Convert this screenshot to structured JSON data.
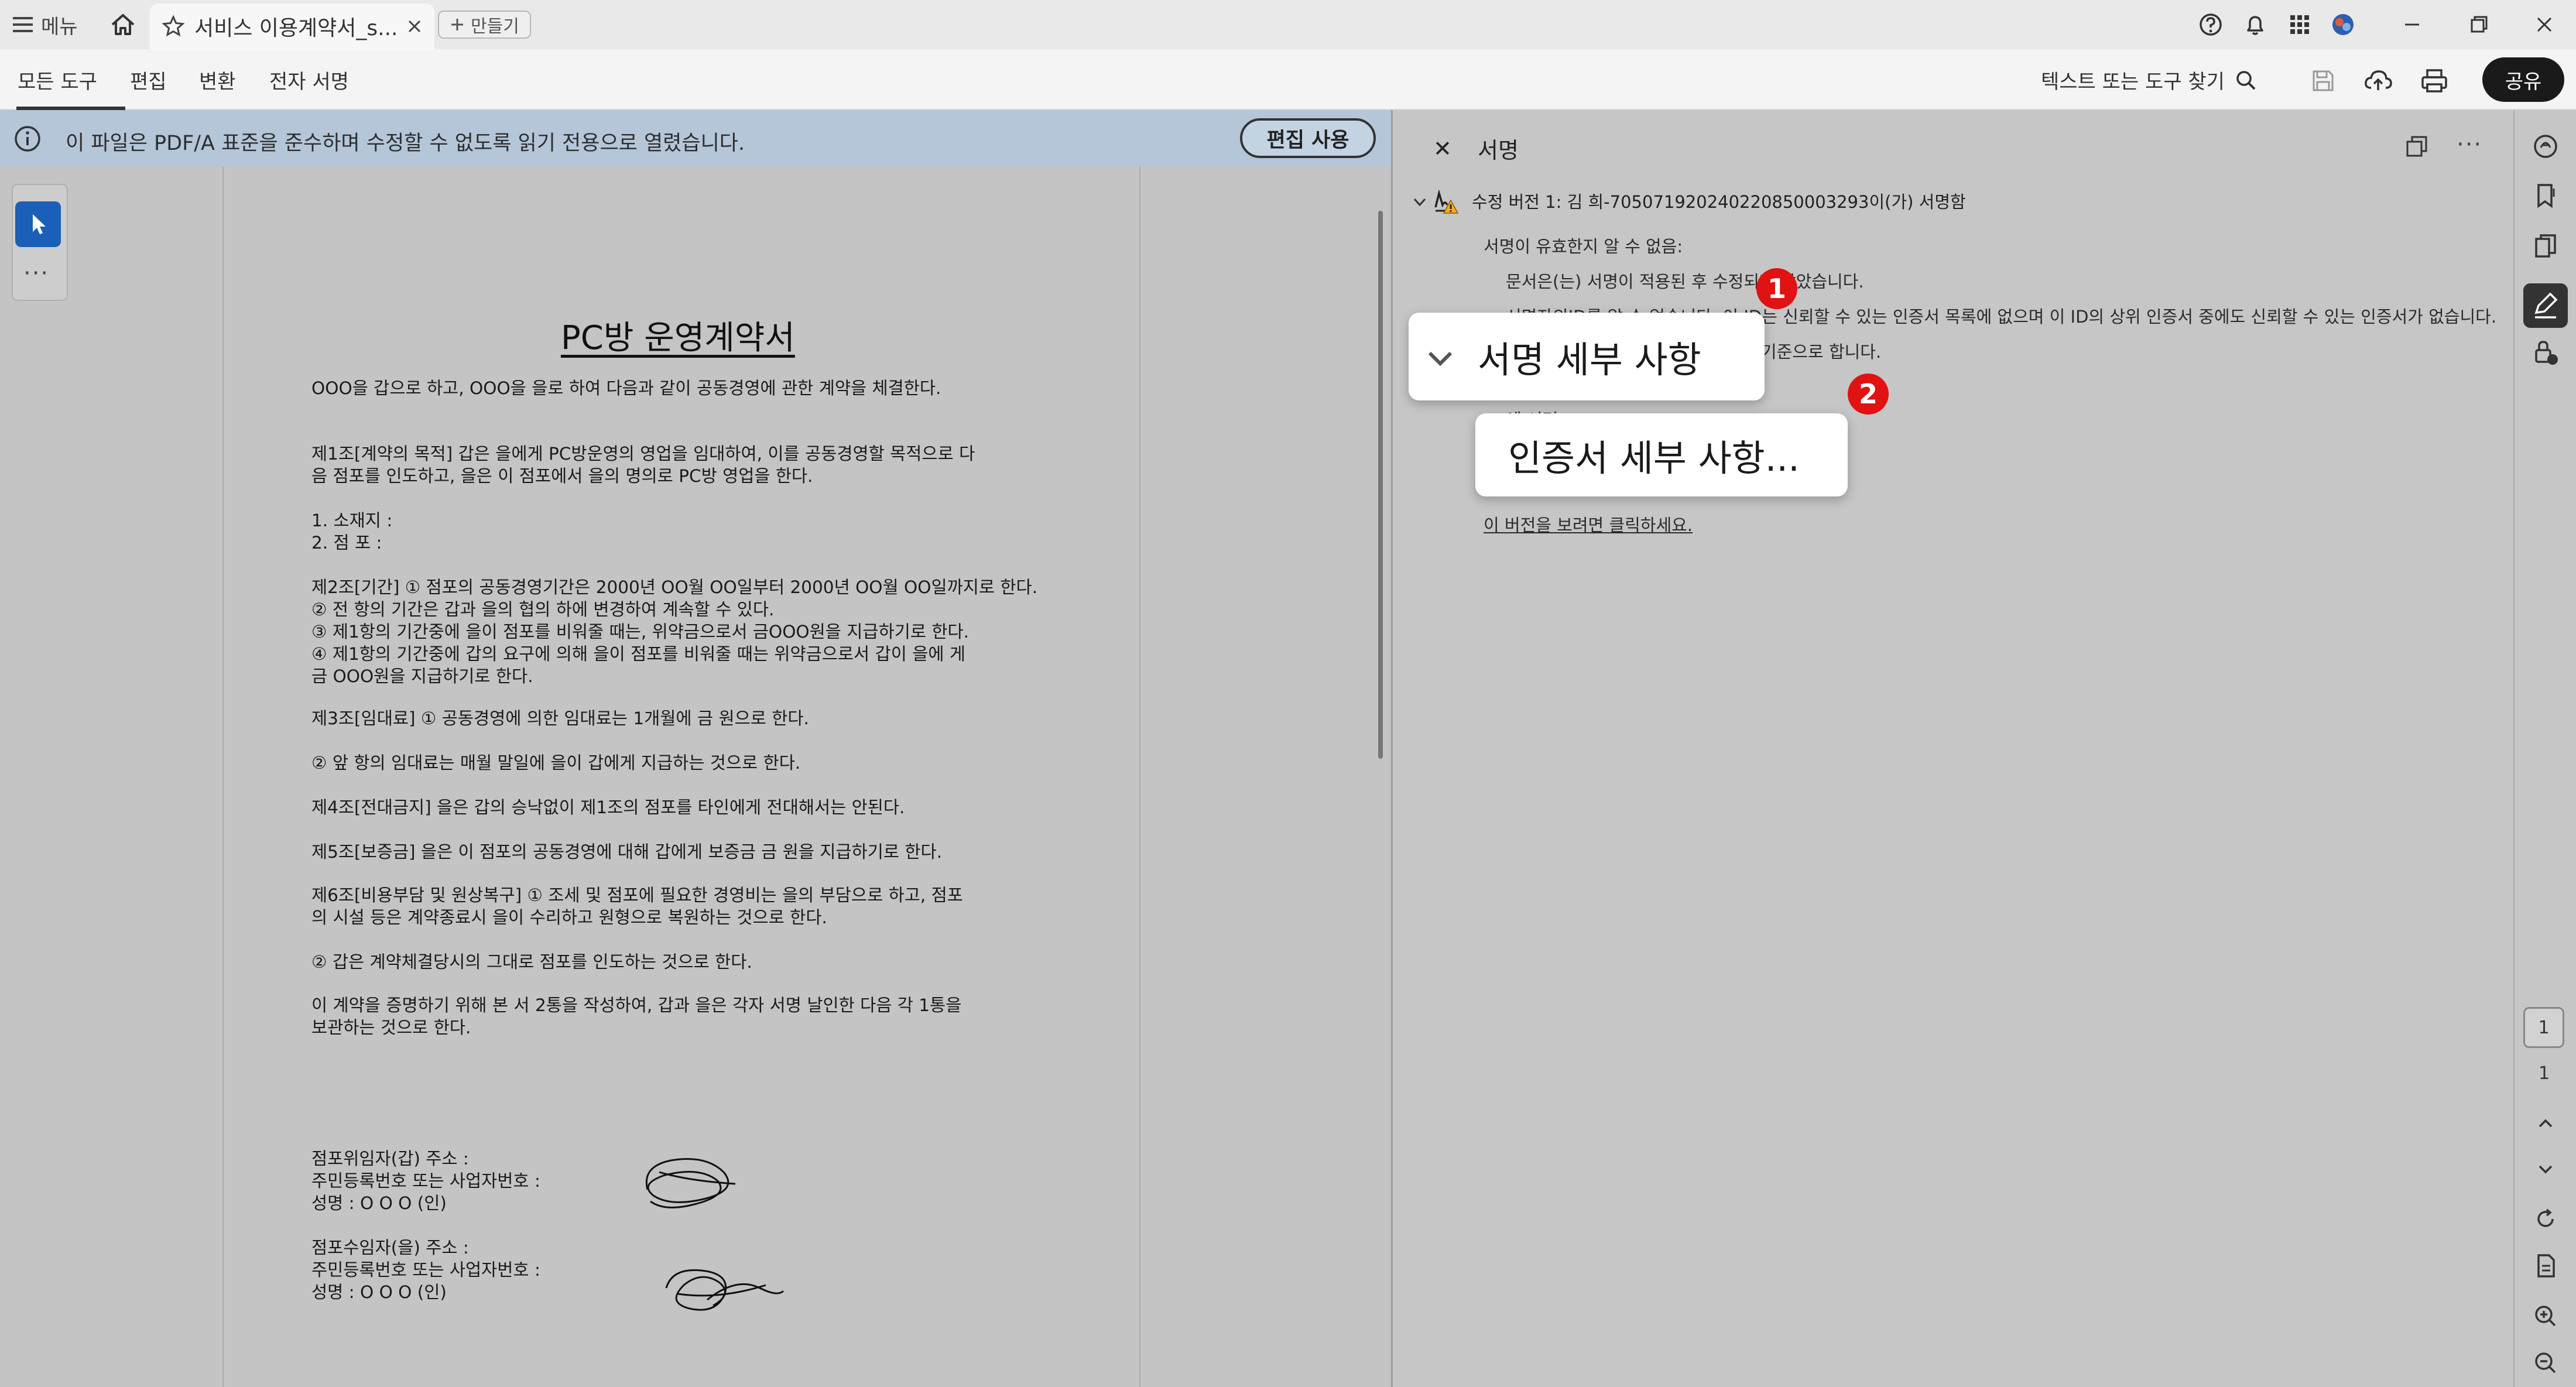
{
  "titlebar": {
    "menu_label": "메뉴",
    "tab_title": "서비스 이용계약서_s...",
    "new_tab_label": "만들기"
  },
  "toolbar": {
    "nav": [
      "모든 도구",
      "편집",
      "변환",
      "전자 서명"
    ],
    "search_label": "텍스트 또는 도구 찾기",
    "share_label": "공유"
  },
  "banner": {
    "text": "이 파일은 PDF/A 표준을 준수하며 수정할 수 없도록 읽기 전용으로 열렸습니다.",
    "edit_button": "편집 사용"
  },
  "document": {
    "title": "PC방 운영계약서",
    "lines": [
      "OOO을 갑으로 하고, OOO을 을로 하여 다음과 같이 공동경영에 관한 계약을 체결한다.",
      "제1조[계약의 목적] 갑은 을에게 PC방운영의 영업을 임대하여, 이를 공동경영할 목적으로 다",
      "음 점포를 인도하고, 을은 이 점포에서 을의 명의로 PC방 영업을 한다.",
      "1. 소재지 :",
      "2. 점 포 :",
      "제2조[기간] ① 점포의 공동경영기간은 2000년 OO월 OO일부터 2000년 OO월 OO일까지로 한다.",
      "② 전 항의 기간은 갑과 을의 협의 하에 변경하여 계속할 수 있다.",
      "③ 제1항의 기간중에 을이 점포를 비워줄 때는, 위약금으로서 금OOO원을 지급하기로 한다.",
      "④ 제1항의 기간중에 갑의 요구에 의해 을이 점포를 비워줄 때는 위약금으로서 갑이 을에 게",
      "금 OOO원을 지급하기로 한다.",
      "제3조[임대료] ① 공동경영에 의한 임대료는 1개월에 금  원으로 한다.",
      "② 앞 항의 임대료는 매월 말일에 을이 갑에게 지급하는 것으로 한다.",
      "제4조[전대금지] 을은 갑의 승낙없이 제1조의 점포를 타인에게 전대해서는 안된다.",
      "제5조[보증금] 을은 이 점포의 공동경영에 대해 갑에게 보증금 금  원을 지급하기로 한다.",
      "제6조[비용부담 및 원상복구] ① 조세 및 점포에 필요한 경영비는 을의 부담으로 하고, 점포",
      "의 시설 등은 계약종료시 을이 수리하고 원형으로 복원하는 것으로 한다.",
      "② 갑은 계약체결당시의 그대로 점포를 인도하는 것으로 한다.",
      "이 계약을 증명하기 위해 본 서 2통을 작성하여, 갑과 을은 각자 서명 날인한 다음 각 1통을",
      "보관하는 것으로 한다.",
      "점포위임자(갑) 주소 :",
      "주민등록번호 또는 사업자번호 :",
      "성명 : O  O O (인)",
      "점포수임자(을) 주소 :",
      "주민등록번호 또는 사업자번호 :",
      "성명 : O  O O (인)"
    ]
  },
  "signature_panel": {
    "title": "서명",
    "version_line": "수정 버전 1: 김   희-705071920240220850003293이(가) 서명함",
    "validity": "서명이 유효한지 알 수 없음:",
    "line1": "문서은(는) 서명이 적용된 후 수정되지 않았습니다.",
    "line2": "서명자의ID를 알 수 없습니다. 이 ID는 신뢰할 수 있는 인증서 목록에 없으며 이 ID의 상위 인증서 중에도 신뢰할 수 있는 인증서가 없습니다.",
    "line3": "기준으로 합니다.",
    "line4": "에 서명",
    "link": "이 버전을 보려면 클릭하세요."
  },
  "callouts": {
    "signature_details": "서명 세부 사항",
    "certificate_details": "인증서 세부 사항...",
    "marker1": "1",
    "marker2": "2"
  },
  "right_rail": {
    "page_current": "1",
    "page_total": "1"
  },
  "colors": {
    "banner_bg": "#b4c6d8",
    "select_tool": "#1b5fb8",
    "marker": "#e01212",
    "share_button": "#1a1a1a"
  }
}
